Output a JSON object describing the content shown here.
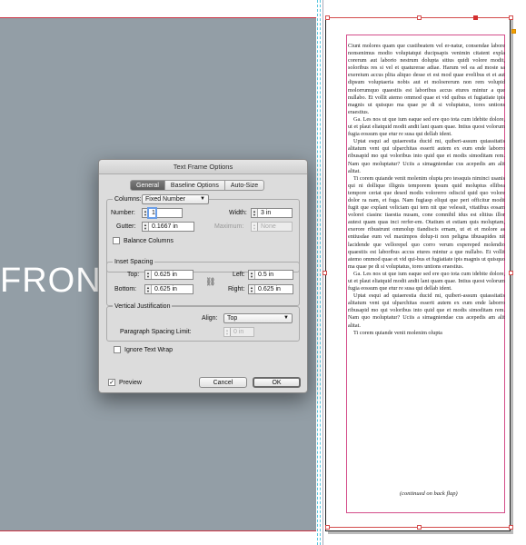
{
  "canvas": {
    "front_label": "FRON",
    "text_frame": {
      "paragraphs": [
        "Ciunt molores quam que custibeatem vel er-natur, consendae labore nonsenimus modio voluptatqui ducipsapis venimin citatent expla corerum aut laborio nestrum dolupta sitius quidi volore modit, soloribus res si vel et quaturerae adiae. Harum vel ea ad moste sa exereium accus plita aliquo desse et est mod quae evelibus et et aut dipsum voluptaeria nobis aut et moloererum non rem volupid molorrumquo quaestiis est laboribus accus etures mintur a que nullabo. Et vollit atemo ommod quae et vid quibus et fugiatiate ipis magnis ut quisquo ma quae pe di si voluptatus, tores untions eraestius.",
        "Ga. Les nos ut que ium eaque sed ere quo tota cum idebite dolore, ut et plaut eliatquid modit andit lant quam quae. Intius quost volorum fugia eossum que etur re susa qui dellab ident.",
        "Uptat esqui ad quiaerestia ducid mi, quiberi-assum quiassitatis alitatum vent qui ulparchitas esserit autem ex eum ende laborro ribusapid mo qui voloribus into quid que et modis simoditam rem. Nam quo moluptatur? Uciis a simagniendae cus acepedis am alit alitat.",
        "Ti corem quiande venit molenim olupta pro tessquis niminci usanis qui ni dollique illignis temporem ipsum quid moluptus ellibea tempore ceriat que desed modis volorerro odiscid quid quo volore dolor ra nam, et fuga. Nam fugiasp eliqui que peri officitur modit fugit que explant veliciam qui tem nit que velessit, vitatibus eosam volorei ciasinc tiaestia nusam, cone comnihil idus est elitius illor autest quam quas inci rerfer-em. Otatium et estiam quis moluptam, exerore ribustrunt ommolup tiandiscis ernam, ut et et molore as entiusdae eum vel maximpos dolup-ti non peligna tibusapides nit lacidende que vellorepel quo corro verum expereped molendio quaestiis est laboribus accus etures mintur a que nullabo. Et vollit atemo ommod quae et vid qui-bus et fugiatiate ipis magnis ut quisquo ma quae pe di si voluptatus, tores untions eraestius.",
        "Ga. Les nos ut que ium eaque sed ere quo tota cum idebite dolore, ut et plaut eliatquid modit andit lant quam quae. Intius quost volorum fugia eossum que etur re susa qui dellab ident.",
        "Uptat esqui ad quiaerestia ducid mi, quiberi-assum quiassitatis alitatum vent qui ulparchitas esserit autem ex eum ende laborro ribusapid mo qui voloribus into quid que et modis simoditam rem. Nam quo moluptatur? Uciis a simagniendae cus acepedis am alit alitat.",
        "Ti corem quiande venit molenim olupta"
      ],
      "continued": "(continued on back flap)"
    }
  },
  "dialog": {
    "title": "Text Frame Options",
    "tabs": [
      "General",
      "Baseline Options",
      "Auto-Size"
    ],
    "columns": {
      "legend": "Columns:",
      "type_value": "Fixed Number",
      "number_label": "Number:",
      "number_value": "1",
      "width_label": "Width:",
      "width_value": "3 in",
      "gutter_label": "Gutter:",
      "gutter_value": "0.1667 in",
      "maximum_label": "Maximum:",
      "maximum_value": "None",
      "balance_label": "Balance Columns",
      "balance_checked": false
    },
    "inset": {
      "legend": "Inset Spacing",
      "top_label": "Top:",
      "top_value": "0.625 in",
      "bottom_label": "Bottom:",
      "bottom_value": "0.625 in",
      "left_label": "Left:",
      "left_value": "0.5 in",
      "right_label": "Right:",
      "right_value": "0.625 in"
    },
    "vertical": {
      "legend": "Vertical Justification",
      "align_label": "Align:",
      "align_value": "Top",
      "spacing_label": "Paragraph Spacing Limit:",
      "spacing_value": "0 in"
    },
    "ignore_wrap_label": "Ignore Text Wrap",
    "ignore_wrap_checked": false,
    "preview_label": "Preview",
    "preview_checked": true,
    "cancel_label": "Cancel",
    "ok_label": "OK"
  },
  "colors": {
    "panel_gray": "#939ea6",
    "frame_red": "#d44d4d",
    "margin_pink": "#d44d8a",
    "guide_cyan": "#5bc8e0",
    "dialog_bg": "#dcdcdc"
  }
}
